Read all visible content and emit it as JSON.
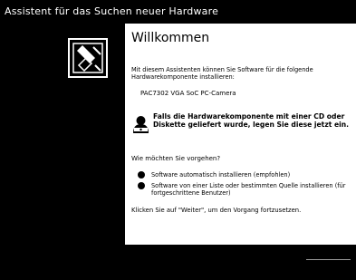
{
  "window": {
    "title": "Assistent für das Suchen neuer Hardware"
  },
  "left_pane": {
    "icon": "hardware-wizard-icon"
  },
  "main": {
    "heading": "Willkommen",
    "intro": "Mit diesem Assistenten können Sie Software für die folgende Hardwarekomponente installieren:",
    "device_name": "PAC7302 VGA SoC PC-Camera",
    "notice_icon": "cd-drive-icon",
    "notice": "Falls die Hardwarekomponente mit einer CD oder Diskette geliefert wurde, legen Sie diese jetzt ein.",
    "question": "Wie möchten Sie vorgehen?",
    "options": [
      {
        "label": "Software automatisch installieren (empfohlen)"
      },
      {
        "label": "Software von einer Liste oder bestimmten Quelle installieren (für fortgeschrittene Benutzer)"
      }
    ],
    "footer": "Klicken Sie auf \"Weiter\", um den Vorgang fortzusetzen."
  }
}
